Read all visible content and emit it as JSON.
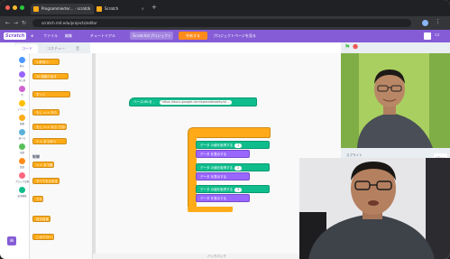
{
  "browser": {
    "tabs": [
      {
        "label": "Programmierter…  · scratch",
        "active": true
      },
      {
        "label": "Scratch",
        "active": false
      }
    ],
    "url": "scratch.mit.edu/projects/editor",
    "new_tab_glyph": "+"
  },
  "menu": {
    "logo": "Scratch",
    "items": [
      "ファイル",
      "編集",
      "チュートリアル"
    ],
    "project_title": "Scratchのプロジェクト",
    "share": "共有する",
    "see_project": "プロジェクトページを見る"
  },
  "editor": {
    "tabs": [
      "コード",
      "コスチューム",
      "音"
    ],
    "categories": [
      {
        "label": "動き",
        "color": "#4c97ff"
      },
      {
        "label": "見た目",
        "color": "#9966ff"
      },
      {
        "label": "音",
        "color": "#cf63cf"
      },
      {
        "label": "イベント",
        "color": "#ffbf00"
      },
      {
        "label": "制御",
        "color": "#ffab19"
      },
      {
        "label": "調べる",
        "color": "#5cb1d6"
      },
      {
        "label": "演算",
        "color": "#59c059"
      },
      {
        "label": "変数",
        "color": "#ff8c1a"
      },
      {
        "label": "ブロック定義",
        "color": "#ff6680"
      },
      {
        "label": "拡張機能",
        "color": "#0fbd8c"
      }
    ],
    "palette_section": "制御",
    "palette_blocks": [
      "1 秒待つ",
      "10 回繰り返す",
      "ずっと",
      "もし < > なら",
      "もし < > なら でなければ",
      "< > まで待つ",
      "< > まで繰り返す",
      "すべてを止める",
      "クローンされたとき",
      "自分自身 のクローンを作る",
      "このクローンを削除する"
    ],
    "script_hat": "ベースURLを 、",
    "script_url": "https://docs.google.com/spreadsheets/d/…",
    "script_blocks": [
      {
        "label": "データ の値を取得する",
        "value": "1"
      },
      {
        "label": "データ を表示する",
        "value": ""
      },
      {
        "label": "データ の値を取得する",
        "value": "2"
      },
      {
        "label": "データ を表示する",
        "value": ""
      },
      {
        "label": "データ の値を取得する",
        "value": "3"
      },
      {
        "label": "データ を表示する",
        "value": ""
      }
    ],
    "status": "バックパック"
  },
  "stage": {
    "green_flag": "⚑",
    "stop": "⬣",
    "sprite_label": "スプライト",
    "sprite_name": "Sprite1",
    "x_label": "x",
    "y_label": "y",
    "stage_label": "ステージ"
  },
  "colors": {
    "menu": "#855cd6",
    "control": "#ffab19",
    "stage_bg": "#b7d96a",
    "sensing": "#5cb1d6",
    "extension": "#0fbd8c",
    "looks": "#9966ff"
  }
}
